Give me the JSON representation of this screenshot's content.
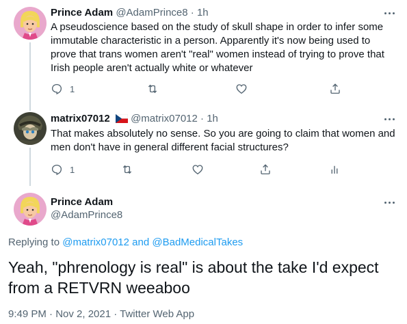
{
  "tweets": [
    {
      "name": "Prince Adam",
      "handle": "@AdamPrince8",
      "separator": "·",
      "time": "1h",
      "text": "A pseudoscience based on the study of skull shape in order to infer some immutable characteristic in a person.  Apparently it's now being used to prove that trans women aren't \"real\" women instead of trying to prove that Irish people aren't actually white or whatever",
      "reply_count": "1"
    },
    {
      "name": "matrix07012",
      "handle": "@matrix07012",
      "separator": "·",
      "time": "1h",
      "flag": "czech-flag",
      "text": "That makes absolutely no sense. So you are going to claim that women and men don't have in general different facial structures?",
      "reply_count": "1"
    }
  ],
  "main_tweet": {
    "name": "Prince Adam",
    "handle": "@AdamPrince8",
    "replying_prefix": "Replying to",
    "replying_user1": "@matrix07012",
    "replying_and": "and",
    "replying_user2": "@BadMedicalTakes",
    "text": "Yeah, \"phrenology is real\" is about the take I'd expect from a RETVRN weeaboo",
    "meta": "9:49 PM · Nov 2, 2021 · Twitter Web App"
  },
  "icons": {
    "reply": "reply-icon",
    "retweet": "retweet-icon",
    "like": "like-icon",
    "share": "share-icon",
    "analytics": "analytics-icon",
    "more": "more-icon"
  }
}
